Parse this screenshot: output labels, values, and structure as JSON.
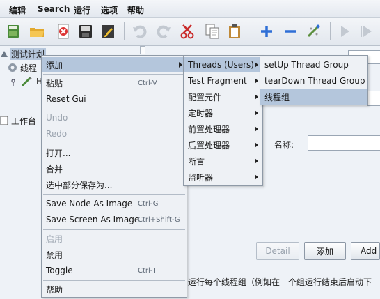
{
  "menubar": [
    "编辑",
    "Search",
    "运行",
    "选项",
    "帮助"
  ],
  "toolbar_icons": [
    "template-icon",
    "open-icon",
    "close-icon",
    "save-icon",
    "edit-icon",
    "undo-icon",
    "redo-icon",
    "cut-icon",
    "copy-icon",
    "paste-icon",
    "expand-icon",
    "collapse-icon",
    "toggle-icon",
    "start-icon",
    "start-no-pause-icon"
  ],
  "tree": {
    "test_plan": "测试计划",
    "thread_group": "线程",
    "child": "H",
    "workbench": "工作台"
  },
  "context_menu": {
    "items": [
      {
        "label": "添加",
        "submenu": true,
        "highlight": true
      },
      {
        "label": "粘贴",
        "shortcut": "Ctrl-V"
      },
      {
        "label": "Reset Gui"
      },
      {
        "label": "Undo",
        "disabled": true
      },
      {
        "label": "Redo",
        "disabled": true
      },
      {
        "label": "打开..."
      },
      {
        "label": "合并"
      },
      {
        "label": "选中部分保存为..."
      },
      {
        "label": "Save Node As Image",
        "shortcut": "Ctrl-G"
      },
      {
        "label": "Save Screen As Image",
        "shortcut": "Ctrl+Shift-G"
      },
      {
        "label": "启用",
        "disabled": true
      },
      {
        "label": "禁用"
      },
      {
        "label": "Toggle",
        "shortcut": "Ctrl-T"
      },
      {
        "label": "帮助"
      }
    ]
  },
  "add_submenu": {
    "items": [
      {
        "label": "Threads (Users)",
        "highlight": true
      },
      {
        "label": "Test Fragment"
      },
      {
        "label": "配置元件"
      },
      {
        "label": "定时器"
      },
      {
        "label": "前置处理器"
      },
      {
        "label": "后置处理器"
      },
      {
        "label": "断言"
      },
      {
        "label": "监听器"
      }
    ]
  },
  "threads_submenu": {
    "items": [
      {
        "label": "setUp Thread Group"
      },
      {
        "label": "tearDown Thread Group"
      },
      {
        "label": "线程组",
        "highlight": true
      }
    ]
  },
  "panel": {
    "name_label": "名称:",
    "buttons": {
      "detail": "Detail",
      "add": "添加",
      "add_from": "Add f"
    },
    "info_text": "运行每个线程组（例如在一个组运行结束后启动下"
  },
  "colors": {
    "highlight": "#b4c6dc",
    "menu_bg": "#eef1f5",
    "page_bg": "#eef2f7"
  }
}
